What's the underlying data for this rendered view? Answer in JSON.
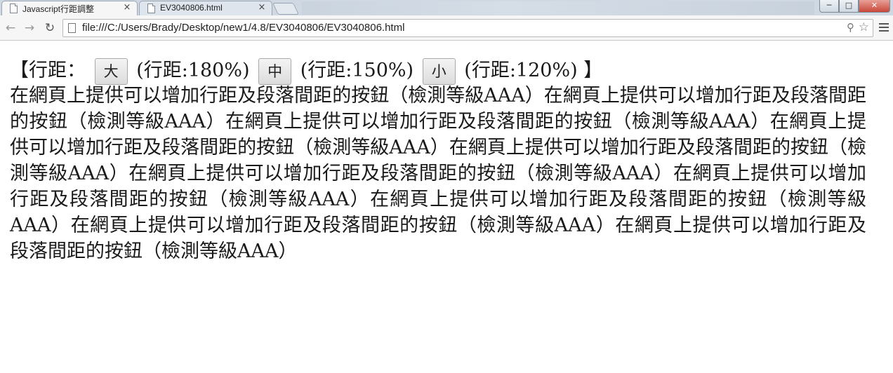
{
  "browser": {
    "tabs": [
      {
        "title": "Javascript行距調整",
        "active": true
      },
      {
        "title": "EV3040806.html",
        "active": false
      }
    ],
    "close_glyph": "×",
    "window_buttons": {
      "minimize": "─",
      "maximize": "□",
      "close": "✕"
    },
    "url": "file:///C:/Users/Brady/Desktop/new1/4.8/EV3040806/EV3040806.html",
    "icons": [
      "back-icon",
      "forward-icon",
      "reload-icon",
      "zoom-icon",
      "star-icon",
      "menu-icon"
    ]
  },
  "page": {
    "controls": {
      "open": "【行距：",
      "close": "】",
      "buttons": [
        {
          "label": "大",
          "note": "(行距:180%)"
        },
        {
          "label": "中",
          "note": "(行距:150%)"
        },
        {
          "label": "小",
          "note": "(行距:120%)"
        }
      ]
    },
    "paragraph": "在網頁上提供可以增加行距及段落間距的按鈕（檢測等級AAA）在網頁上提供可以增加行距及段落間距的按鈕（檢測等級AAA）在網頁上提供可以增加行距及段落間距的按鈕（檢測等級AAA）在網頁上提供可以增加行距及段落間距的按鈕（檢測等級AAA）在網頁上提供可以增加行距及段落間距的按鈕（檢測等級AAA）在網頁上提供可以增加行距及段落間距的按鈕（檢測等級AAA）在網頁上提供可以增加行距及段落間距的按鈕（檢測等級AAA）在網頁上提供可以增加行距及段落間距的按鈕（檢測等級AAA）在網頁上提供可以增加行距及段落間距的按鈕（檢測等級AAA）在網頁上提供可以增加行距及段落間距的按鈕（檢測等級AAA）"
  }
}
